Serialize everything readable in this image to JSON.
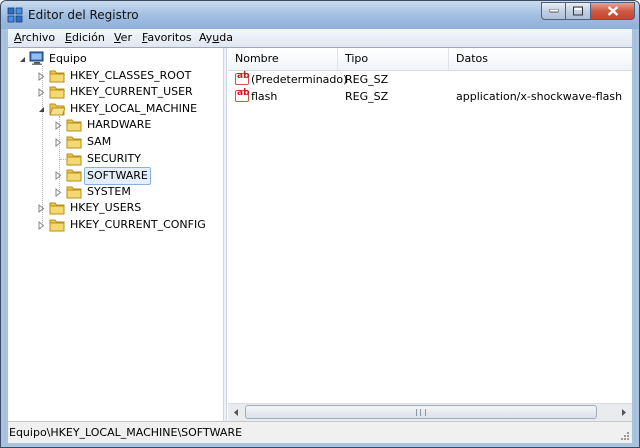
{
  "window": {
    "title": "Editor del Registro",
    "minimize_icon": "minimize-icon",
    "maximize_icon": "maximize-icon",
    "close_icon": "close-icon"
  },
  "menu": {
    "items": [
      {
        "accel": "A",
        "rest": "rchivo"
      },
      {
        "accel": "E",
        "rest": "dición"
      },
      {
        "accel": "V",
        "rest": "er"
      },
      {
        "accel": "F",
        "rest": "avoritos"
      },
      {
        "pre": "Ay",
        "accel": "u",
        "rest": "da"
      }
    ]
  },
  "tree": {
    "root": "Equipo",
    "nodes": [
      {
        "label": "HKEY_CLASSES_ROOT",
        "expanded": false
      },
      {
        "label": "HKEY_CURRENT_USER",
        "expanded": false
      },
      {
        "label": "HKEY_LOCAL_MACHINE",
        "expanded": true,
        "children": [
          "HARDWARE",
          "SAM",
          "SECURITY",
          "SOFTWARE",
          "SYSTEM"
        ]
      },
      {
        "label": "HKEY_USERS",
        "expanded": false
      },
      {
        "label": "HKEY_CURRENT_CONFIG",
        "expanded": false
      }
    ],
    "selected": "SOFTWARE"
  },
  "list": {
    "columns": [
      "Nombre",
      "Tipo",
      "Datos"
    ],
    "rows": [
      {
        "name": "(Predeterminado)",
        "type": "REG_SZ",
        "data": ""
      },
      {
        "name": "flash",
        "type": "REG_SZ",
        "data": "application/x-shockwave-flash"
      }
    ],
    "value_icon_text": "ab"
  },
  "statusbar": {
    "path": "Equipo\\HKEY_LOCAL_MACHINE\\SOFTWARE"
  }
}
